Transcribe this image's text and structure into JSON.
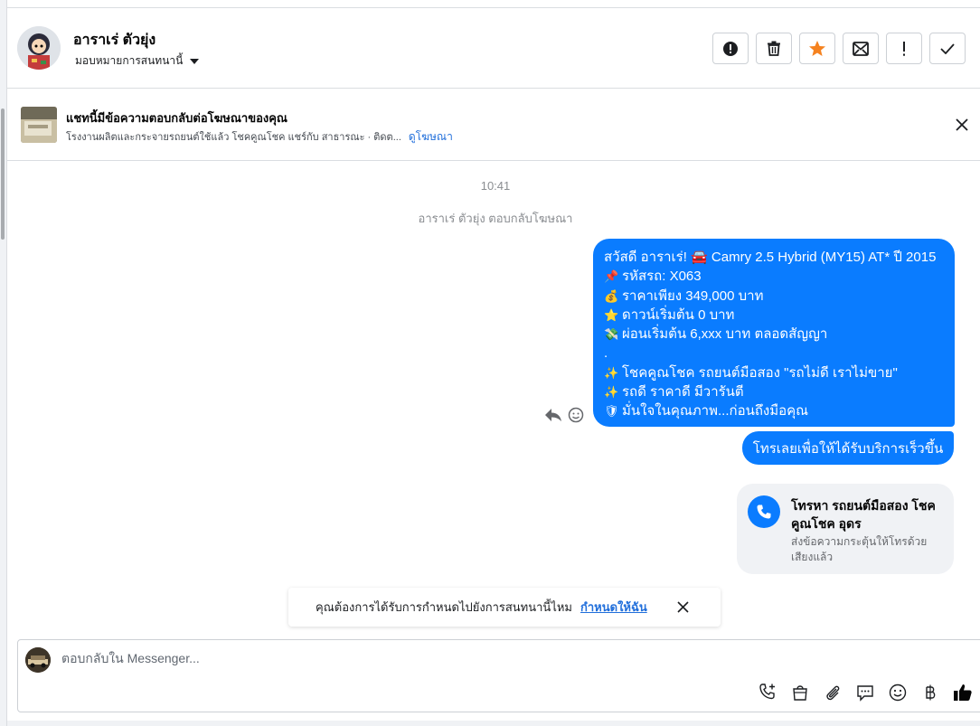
{
  "header": {
    "contact_name": "อาราเร่ ตัวยุ่ง",
    "assign_label": "มอบหมายการสนทนานี้",
    "actions": [
      "spam-icon",
      "trash-icon",
      "star-icon",
      "mark-unread-icon",
      "follow-up-icon",
      "done-check-icon"
    ]
  },
  "ad_banner": {
    "title": "แชทนี้มีข้อความตอบกลับต่อโฆษณาของคุณ",
    "subtitle": "โรงงานผลิตและกระจายรถยนต์ใช้แล้ว โชคคูณโชค แชร์กับ สาธารณะ · ติดต...",
    "link": "ดูโฆษณา"
  },
  "chat": {
    "timestamp": "10:41",
    "reply_note": "อาราเร่ ตัวยุ่ง ตอบกลับโฆษณา",
    "main_message": {
      "lines": [
        {
          "emoji": "",
          "text": "สวัสดี อาราเร่! 🚘 Camry 2.5 Hybrid (MY15) AT* ปี 2015"
        },
        {
          "emoji": "📌",
          "text": "รหัสรถ: X063"
        },
        {
          "emoji": "💰",
          "text": "ราคาเพียง 349,000 บาท"
        },
        {
          "emoji": "⭐",
          "text": "ดาวน์เริ่มต้น 0 บาท"
        },
        {
          "emoji": "💸",
          "text": "ผ่อนเริ่มต้น 6,xxx บาท ตลอดสัญญา"
        },
        {
          "emoji": "",
          "text": "."
        },
        {
          "emoji": "✨",
          "text": "โชคคูณโชค รถยนต์มือสอง \"รถไม่ดี เราไม่ขาย\""
        },
        {
          "emoji": "✨",
          "text": "รถดี ราคาดี มีวารันตี"
        },
        {
          "emoji": "🛡",
          "text": "มั่นใจในคุณภาพ...ก่อนถึงมือคุณ"
        }
      ]
    },
    "second_message": "โทรเลยเพื่อให้ได้รับบริการเร็วขึ้น",
    "call_card": {
      "title": "โทรหา รถยนต์มือสอง โชคคูณโชค อุดร",
      "subtitle": "ส่งข้อความกระตุ้นให้โทรด้วยเสียงแล้ว"
    }
  },
  "reminder": {
    "text": "คุณต้องการได้รับการกำหนดไปยังการสนทนานี้ไหม",
    "link": "กำหนดให้ฉัน"
  },
  "composer": {
    "placeholder": "ตอบกลับใน Messenger...",
    "tools": [
      "add-call-icon",
      "shop-bag-icon",
      "attachment-icon",
      "saved-replies-icon",
      "emoji-icon",
      "baht-icon",
      "thumbs-up-icon"
    ],
    "accent": "#0a7cff"
  }
}
